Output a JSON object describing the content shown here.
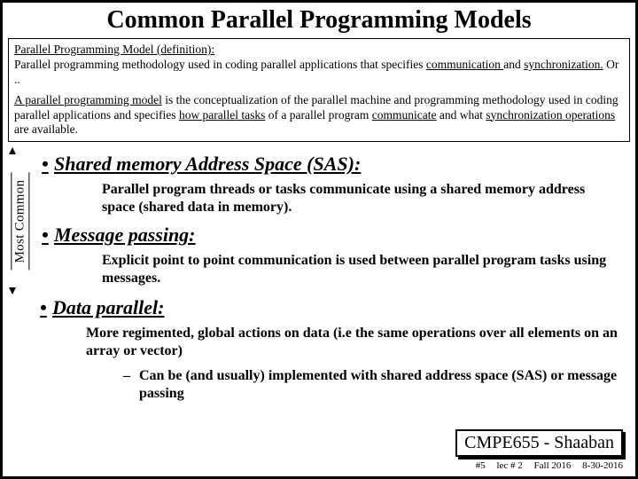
{
  "title": "Common Parallel Programming Models",
  "definition": {
    "heading": "Parallel Programming Model (definition):",
    "line1_a": "Parallel programming methodology used in coding parallel applications that specifies ",
    "line1_u1": "communication ",
    "line1_b": "and ",
    "line1_u2": "synchronization.",
    "line1_c": "  Or ..",
    "line2_u1": "A parallel programming model",
    "line2_a": " is the conceptualization of the parallel machine and programming methodology used in coding parallel applications and specifies ",
    "line2_u2": "how parallel tasks",
    "line2_b": " of a parallel program ",
    "line2_u3": "communicate",
    "line2_c": " and what ",
    "line2_u4": "synchronization operations",
    "line2_d": " are available."
  },
  "most_common_label": "Most Common",
  "bullets": {
    "sas": {
      "title": "Shared memory Address Space (SAS):",
      "desc": "Parallel program threads or tasks communicate using a shared memory address space (shared data in memory)."
    },
    "mp": {
      "title": "Message passing:",
      "desc": "Explicit point to point communication is used between parallel program tasks using messages."
    },
    "dp": {
      "title": "Data parallel:",
      "desc": "More regimented, global actions on data (i.e the same operations over all elements on an array or vector)",
      "sub": "Can be (and usually) implemented with shared address space (SAS) or message passing"
    }
  },
  "footer": {
    "box": "CMPE655 - Shaaban",
    "slide_no": "#5",
    "lec": "lec # 2",
    "term": "Fall 2016",
    "date": "8-30-2016"
  }
}
